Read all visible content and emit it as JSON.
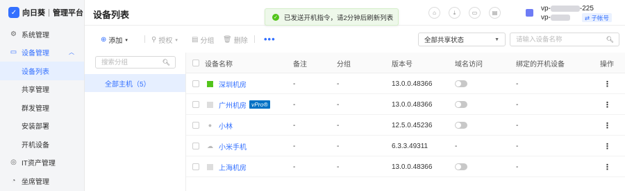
{
  "brand": {
    "logo_char": "✓",
    "name": "向日葵",
    "sub": "管理平台"
  },
  "sidebar": {
    "items": [
      {
        "label": "系统管理",
        "icon": "gear-icon"
      },
      {
        "label": "设备管理",
        "icon": "monitor-icon",
        "expanded": true
      },
      {
        "label": "IT资产管理",
        "icon": "asset-icon"
      },
      {
        "label": "坐席管理",
        "icon": "seat-icon"
      }
    ],
    "sub_items": [
      {
        "label": "设备列表",
        "active": true
      },
      {
        "label": "共享管理"
      },
      {
        "label": "群发管理"
      },
      {
        "label": "安装部署"
      },
      {
        "label": "开机设备"
      }
    ]
  },
  "header": {
    "title": "设备列表",
    "toast": "已发送开机指令，请2分钟后刷新列表",
    "user_line1_prefix": "vp-",
    "user_line1_suffix": "-225",
    "user_line2_prefix": "vp-",
    "sub_account": "⇄ 子帐号"
  },
  "toolbar": {
    "add": "添加",
    "authorize": "授权",
    "group": "分组",
    "delete": "删除",
    "more": "•••",
    "share_filter": "全部共享状态",
    "search_placeholder": "请输入设备名称"
  },
  "groups": {
    "search_placeholder": "搜索分组",
    "all_hosts": "全部主机（5）"
  },
  "table": {
    "columns": [
      "设备名称",
      "备注",
      "分组",
      "版本号",
      "域名访问",
      "绑定的开机设备",
      "操作"
    ],
    "rows": [
      {
        "name": "深圳机房",
        "os": "windows",
        "vpro": "",
        "remark": "-",
        "group": "-",
        "version": "13.0.0.48366",
        "domain_access": "off",
        "bound": "-"
      },
      {
        "name": "广州机房",
        "os": "generic",
        "vpro": "vPro®",
        "remark": "-",
        "group": "-",
        "version": "13.0.0.48366",
        "domain_access": "off",
        "bound": "-"
      },
      {
        "name": "小林",
        "os": "apple",
        "vpro": "",
        "remark": "-",
        "group": "-",
        "version": "12.5.0.45236",
        "domain_access": "off",
        "bound": "-"
      },
      {
        "name": "小米手机",
        "os": "cloud",
        "vpro": "",
        "remark": "-",
        "group": "-",
        "version": "6.3.3.49311",
        "domain_access": "-",
        "bound": "-"
      },
      {
        "name": "上海机房",
        "os": "generic",
        "vpro": "",
        "remark": "-",
        "group": "-",
        "version": "13.0.0.48366",
        "domain_access": "off",
        "bound": "-"
      }
    ]
  },
  "colors": {
    "accent": "#3370ff",
    "success": "#52c41a",
    "vpro": "#0071c5"
  }
}
